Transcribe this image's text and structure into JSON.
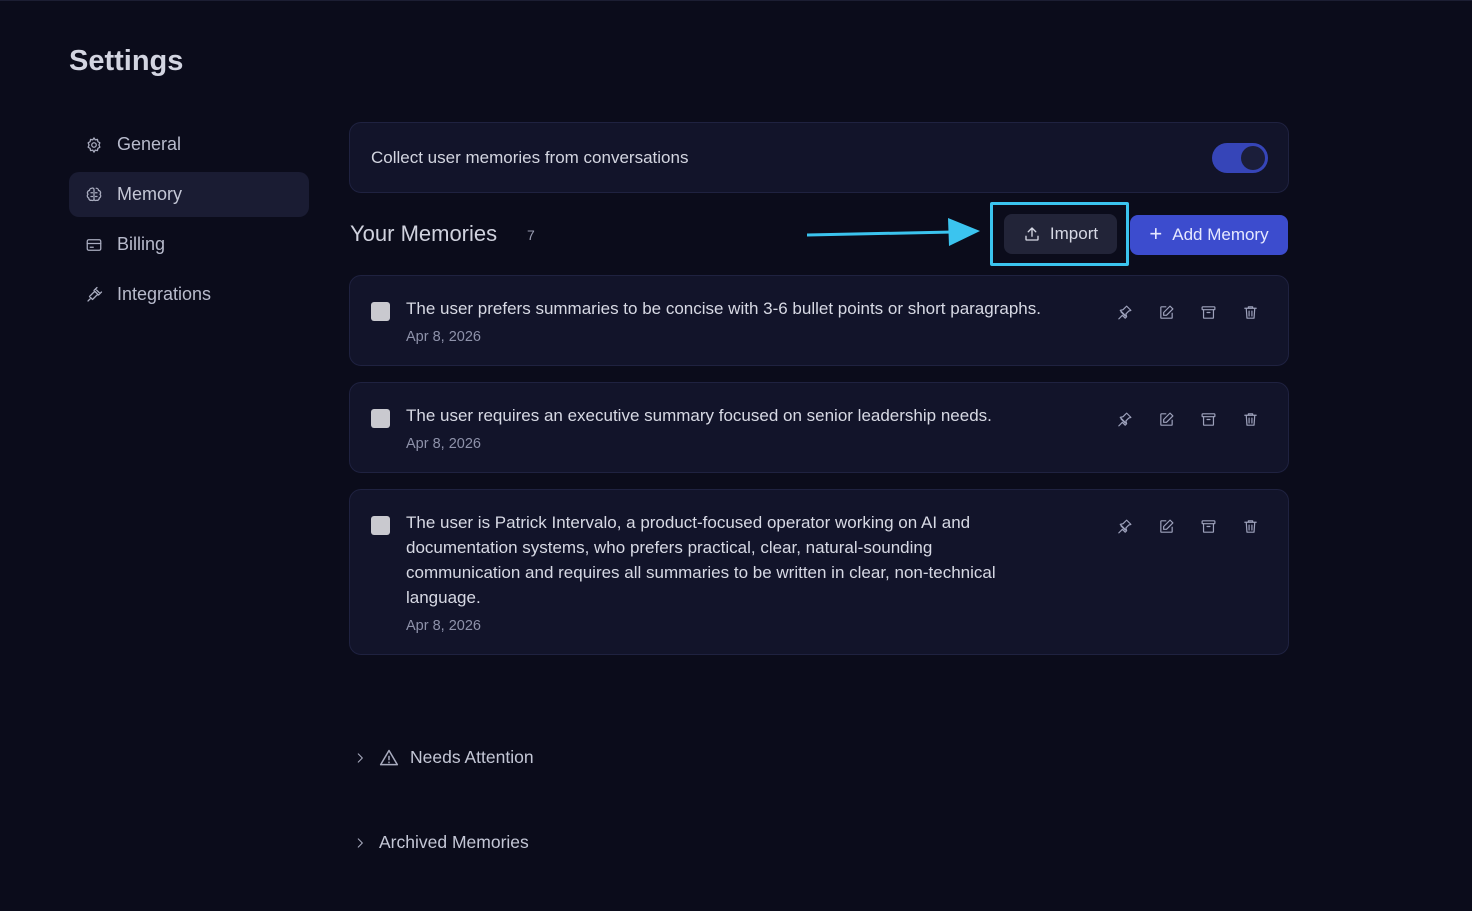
{
  "page": {
    "title": "Settings"
  },
  "sidebar": {
    "items": [
      {
        "label": "General",
        "icon": "gear-icon",
        "active": false
      },
      {
        "label": "Memory",
        "icon": "brain-icon",
        "active": true
      },
      {
        "label": "Billing",
        "icon": "credit-card-icon",
        "active": false
      },
      {
        "label": "Integrations",
        "icon": "plug-icon",
        "active": false
      }
    ]
  },
  "settings": {
    "collect_label": "Collect user memories from conversations",
    "collect_enabled": true
  },
  "memories": {
    "title": "Your Memories",
    "count": "7",
    "import_label": "Import",
    "add_label": "Add Memory",
    "items": [
      {
        "text": "The user prefers summaries to be concise with 3-6 bullet points or short paragraphs.",
        "date": "Apr 8, 2026"
      },
      {
        "text": "The user requires an executive summary focused on senior leadership needs.",
        "date": "Apr 8, 2026"
      },
      {
        "text": "The user is Patrick Intervalo, a product-focused operator working on AI and documentation systems, who prefers practical, clear, natural-sounding communication and requires all summaries to be written in clear, non-technical language.",
        "date": "Apr 8, 2026"
      }
    ]
  },
  "sections": {
    "needs_attention": "Needs Attention",
    "archived": "Archived Memories"
  },
  "colors": {
    "background": "#0b0c1b",
    "card": "#12142a",
    "accent": "#3c4cce",
    "highlight": "#3bc4ef"
  }
}
